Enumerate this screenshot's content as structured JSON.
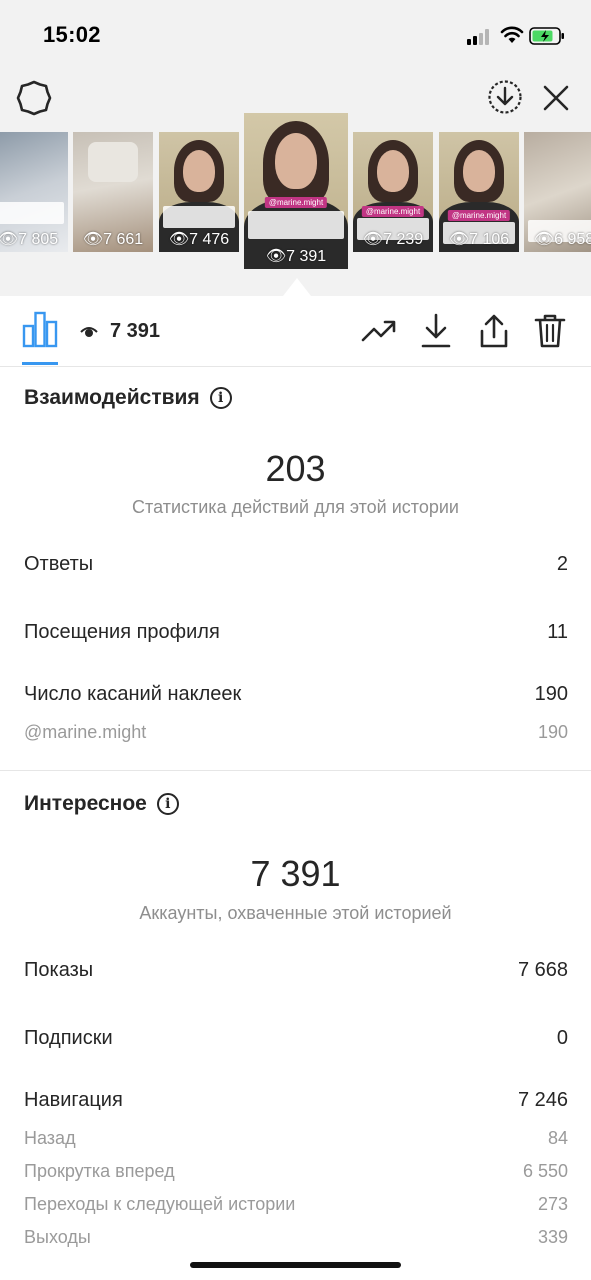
{
  "status_bar": {
    "time": "15:02"
  },
  "stories": [
    {
      "views": "7 805",
      "active": false
    },
    {
      "views": "7 661",
      "active": false
    },
    {
      "views": "7 476",
      "active": false
    },
    {
      "views": "7 391",
      "active": true,
      "tag": "@marine.might"
    },
    {
      "views": "7 239",
      "active": false,
      "tag": "@marine.might"
    },
    {
      "views": "7 106",
      "active": false,
      "tag": "@marine.might"
    },
    {
      "views": "6 958",
      "active": false
    }
  ],
  "tabbar": {
    "views_count": "7 391"
  },
  "interactions": {
    "title": "Взаимодействия",
    "total": "203",
    "caption": "Статистика действий для этой истории",
    "rows": [
      {
        "label": "Ответы",
        "value": "2"
      },
      {
        "label": "Посещения профиля",
        "value": "11"
      },
      {
        "label": "Число касаний наклеек",
        "value": "190"
      }
    ],
    "sticker_detail": {
      "label": "@marine.might",
      "value": "190"
    }
  },
  "discovery": {
    "title": "Интересное",
    "total": "7 391",
    "caption": "Аккаунты, охваченные этой историей",
    "rows": [
      {
        "label": "Показы",
        "value": "7 668"
      },
      {
        "label": "Подписки",
        "value": "0"
      },
      {
        "label": "Навигация",
        "value": "7 246"
      }
    ],
    "navigation_details": [
      {
        "label": "Назад",
        "value": "84"
      },
      {
        "label": "Прокрутка вперед",
        "value": "6 550"
      },
      {
        "label": "Переходы к следующей истории",
        "value": "273"
      },
      {
        "label": "Выходы",
        "value": "339"
      }
    ]
  },
  "colors": {
    "accent": "#3897f0",
    "tag": "#c13584",
    "battery": "#4cd964"
  }
}
